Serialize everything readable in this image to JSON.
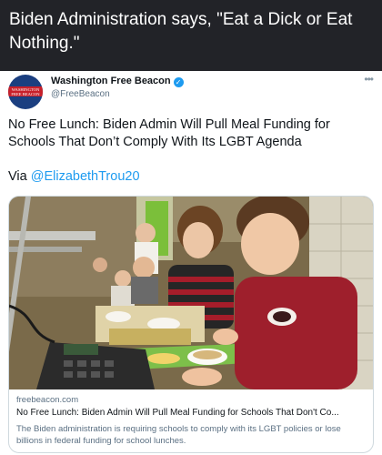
{
  "meme": {
    "caption": "Biden Administration says, \"Eat a Dick or Eat Nothing.\""
  },
  "tweet": {
    "author_name": "Washington Free Beacon",
    "author_handle": "@FreeBeacon",
    "avatar_text_line1": "WASHINGTON",
    "avatar_text_line2": "FREE BEACON",
    "verified_glyph": "✓",
    "more_icon": "•••",
    "text": "No Free Lunch: Biden Admin Will Pull Meal Funding for Schools That Don’t Comply With Its LGBT Agenda",
    "via_prefix": "Via ",
    "via_mention": "@ElizabethTrou20"
  },
  "card": {
    "domain": "freebeacon.com",
    "title": "No Free Lunch: Biden Admin Will Pull Meal Funding for Schools That Don't Co...",
    "description": "The Biden administration is requiring schools to comply with its LGBT policies or lose billions in federal funding for school lunches."
  },
  "colors": {
    "header_bg": "#222328",
    "link_blue": "#1d9bf0",
    "avatar_navy": "#1b3f80",
    "avatar_red": "#c8202a"
  }
}
